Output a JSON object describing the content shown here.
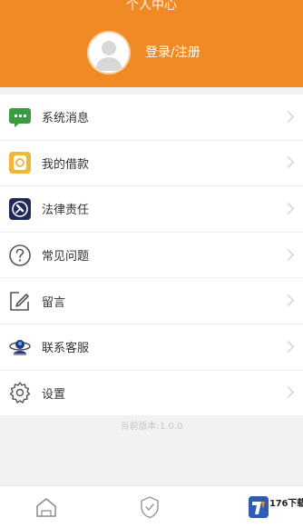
{
  "header": {
    "title": "个人中心",
    "login_label": "登录/注册"
  },
  "menu": {
    "items": [
      {
        "label": "系统消息",
        "icon": "message-icon"
      },
      {
        "label": "我的借款",
        "icon": "wallet-icon"
      },
      {
        "label": "法律责任",
        "icon": "legal-icon"
      },
      {
        "label": "常见问题",
        "icon": "question-icon"
      },
      {
        "label": "留言",
        "icon": "edit-icon"
      },
      {
        "label": "联系客服",
        "icon": "service-icon"
      },
      {
        "label": "设置",
        "icon": "gear-icon"
      }
    ]
  },
  "footer": {
    "version_text": "当前版本:1.0.0"
  },
  "tabbar": {
    "items": [
      {
        "icon": "home-icon"
      },
      {
        "icon": "shield-icon"
      }
    ]
  },
  "watermark": {
    "text": "176下载网"
  },
  "colors": {
    "brand": "#f08a24",
    "message_green": "#3a9c41",
    "wallet_yellow": "#f0b73c",
    "legal_navy": "#1f2a58"
  }
}
